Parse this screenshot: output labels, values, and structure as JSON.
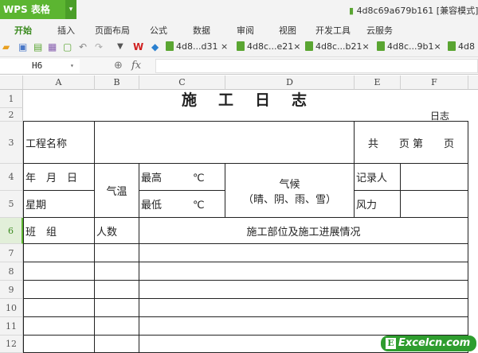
{
  "app": {
    "logo": "WPS 表格",
    "doc_title": "4d8c69a679b161 [兼容模式] -"
  },
  "menu": [
    "开始",
    "插入",
    "页面布局",
    "公式",
    "数据",
    "审阅",
    "视图",
    "开发工具",
    "云服务"
  ],
  "menu_active": "开始",
  "doc_tabs": [
    "4d8...d31 ×",
    "4d8c...e21×",
    "4d8c...b21×",
    "4d8c...9b1×",
    "4d8"
  ],
  "formula_bar": {
    "cell_ref": "H6",
    "fx": "fx",
    "value": ""
  },
  "columns": [
    "A",
    "B",
    "C",
    "D",
    "E",
    "F"
  ],
  "rows": [
    "1",
    "2",
    "3",
    "4",
    "5",
    "6",
    "7",
    "8",
    "9",
    "10",
    "11",
    "12"
  ],
  "selected_row": "6",
  "sheet": {
    "title": "施　工　日　志",
    "subtitle": "日志",
    "project_name": "工程名称",
    "page_info": "共　　页 第　　页",
    "date": "年　月　日",
    "weekday": "星期",
    "temperature": "气温",
    "high": "最高　　　℃",
    "low": "最低　　　℃",
    "weather": "气候",
    "weather_options": "（晴、阴、雨、雪）",
    "recorder": "记录人",
    "wind": "风力",
    "team": "班　组",
    "headcount": "人数",
    "progress": "施工部位及施工进展情况"
  },
  "watermark": {
    "letter": "E",
    "text": "Excelcn.com"
  },
  "colors": {
    "accent": "#5cb531"
  }
}
